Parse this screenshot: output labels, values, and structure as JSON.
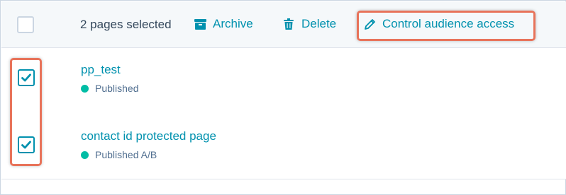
{
  "bulk_bar": {
    "selected_count_text": "2 pages selected",
    "actions": {
      "archive": {
        "label": "Archive",
        "icon": "archive-icon"
      },
      "delete": {
        "label": "Delete",
        "icon": "trash-icon"
      },
      "control_access": {
        "label": "Control audience access",
        "icon": "pencil-icon"
      }
    }
  },
  "rows": [
    {
      "name": "pp_test",
      "status": "Published",
      "checked": true
    },
    {
      "name": "contact id protected page",
      "status": "Published A/B",
      "checked": true
    }
  ],
  "select_all_checked": false,
  "colors": {
    "accent": "#0091ae",
    "text": "#33475b",
    "status_published": "#00bda5",
    "highlight": "#e8735a",
    "bar_background": "#f5f8fa"
  }
}
